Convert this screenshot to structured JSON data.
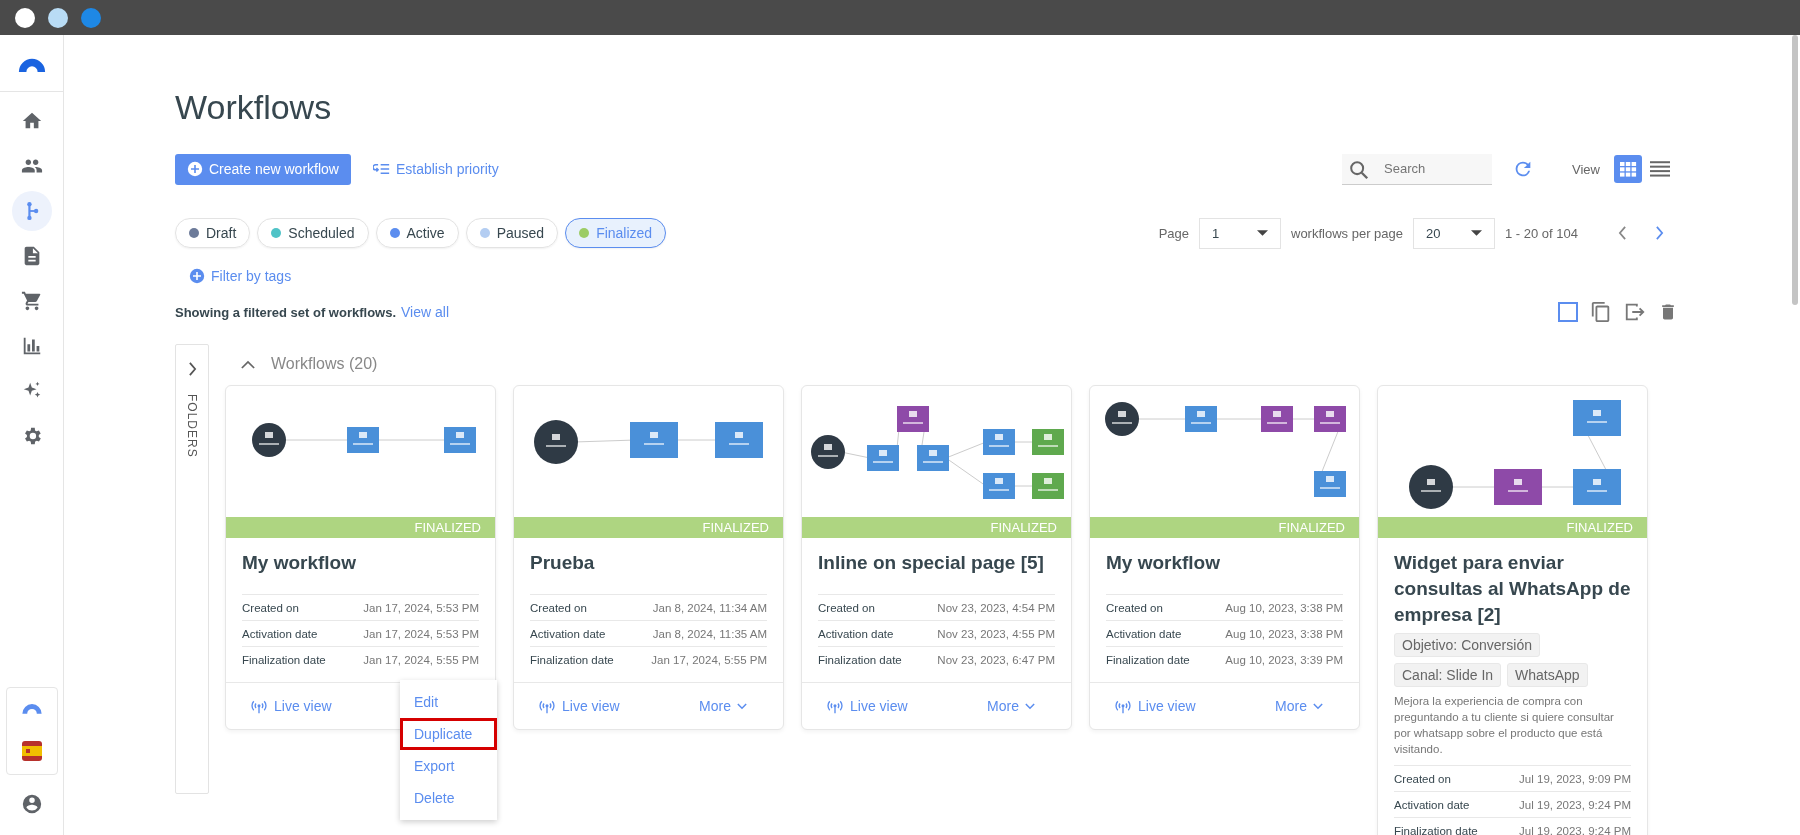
{
  "sidebar": {
    "items": [
      {
        "selected": false
      },
      {
        "selected": false
      },
      {
        "selected": true
      },
      {
        "selected": false
      },
      {
        "selected": false
      },
      {
        "selected": false
      },
      {
        "selected": false
      },
      {
        "selected": false
      }
    ]
  },
  "page_title": "Workflows",
  "create_button": "Create new workflow",
  "priority_link": "Establish priority",
  "search": {
    "placeholder": "Search"
  },
  "view": {
    "label": "View",
    "modes": [
      {
        "selected": true
      },
      {
        "selected": false
      }
    ]
  },
  "status_filters": [
    {
      "label": "Draft",
      "color": "#6c7a99",
      "selected": false
    },
    {
      "label": "Scheduled",
      "color": "#4fc3c7",
      "selected": false
    },
    {
      "label": "Active",
      "color": "#5b8def",
      "selected": false
    },
    {
      "label": "Paused",
      "color": "#b3cdf2",
      "selected": false
    },
    {
      "label": "Finalized",
      "color": "#9ccc65",
      "selected": true
    }
  ],
  "pagination": {
    "page_label": "Page",
    "page": "1",
    "per_page_label": "workflows per page",
    "per_page": "20",
    "range": "1 - 20 of 104"
  },
  "filter_by_tags": "Filter by tags",
  "select_all": {
    "checked": false
  },
  "filter_notice": {
    "text": "Showing a filtered set of workflows.",
    "link": "View all"
  },
  "folders_label": "FOLDERS",
  "group": {
    "title": "Workflows (20)",
    "expanded": true
  },
  "cards": [
    {
      "status": "FINALIZED",
      "title": "My workflow",
      "rows": [
        {
          "label": "Created on",
          "value": "Jan 17, 2024, 5:53 PM"
        },
        {
          "label": "Activation date",
          "value": "Jan 17, 2024, 5:53 PM"
        },
        {
          "label": "Finalization date",
          "value": "Jan 17, 2024, 5:55 PM"
        }
      ],
      "live_view": "Live view",
      "menu": [
        {
          "label": "Edit",
          "highlighted": false
        },
        {
          "label": "Duplicate",
          "highlighted": true
        },
        {
          "label": "Export",
          "highlighted": false
        },
        {
          "label": "Delete",
          "highlighted": false
        }
      ]
    },
    {
      "status": "FINALIZED",
      "title": "Prueba",
      "rows": [
        {
          "label": "Created on",
          "value": "Jan 8, 2024, 11:34 AM"
        },
        {
          "label": "Activation date",
          "value": "Jan 8, 2024, 11:35 AM"
        },
        {
          "label": "Finalization date",
          "value": "Jan 17, 2024, 5:55 PM"
        }
      ],
      "live_view": "Live view",
      "more": "More"
    },
    {
      "status": "FINALIZED",
      "title": "Inline on special page [5]",
      "rows": [
        {
          "label": "Created on",
          "value": "Nov 23, 2023, 4:54 PM"
        },
        {
          "label": "Activation date",
          "value": "Nov 23, 2023, 4:55 PM"
        },
        {
          "label": "Finalization date",
          "value": "Nov 23, 2023, 6:47 PM"
        }
      ],
      "live_view": "Live view",
      "more": "More"
    },
    {
      "status": "FINALIZED",
      "title": "My workflow",
      "rows": [
        {
          "label": "Created on",
          "value": "Aug 10, 2023, 3:38 PM"
        },
        {
          "label": "Activation date",
          "value": "Aug 10, 2023, 3:38 PM"
        },
        {
          "label": "Finalization date",
          "value": "Aug 10, 2023, 3:39 PM"
        }
      ],
      "live_view": "Live view",
      "more": "More"
    },
    {
      "status": "FINALIZED",
      "title": "Widget para enviar consultas al WhatsApp de empresa [2]",
      "tags": [
        "Objetivo: Conversión",
        "Canal: Slide In",
        "WhatsApp"
      ],
      "description": "Mejora la experiencia de compra con preguntando a tu cliente si quiere consultar por whatsapp sobre el producto que está visitando.",
      "rows": [
        {
          "label": "Created on",
          "value": "Jul 19, 2023, 9:09 PM"
        },
        {
          "label": "Activation date",
          "value": "Jul 19, 2023, 9:24 PM"
        },
        {
          "label": "Finalization date",
          "value": "Jul 19, 2023, 9:24 PM"
        }
      ]
    }
  ]
}
